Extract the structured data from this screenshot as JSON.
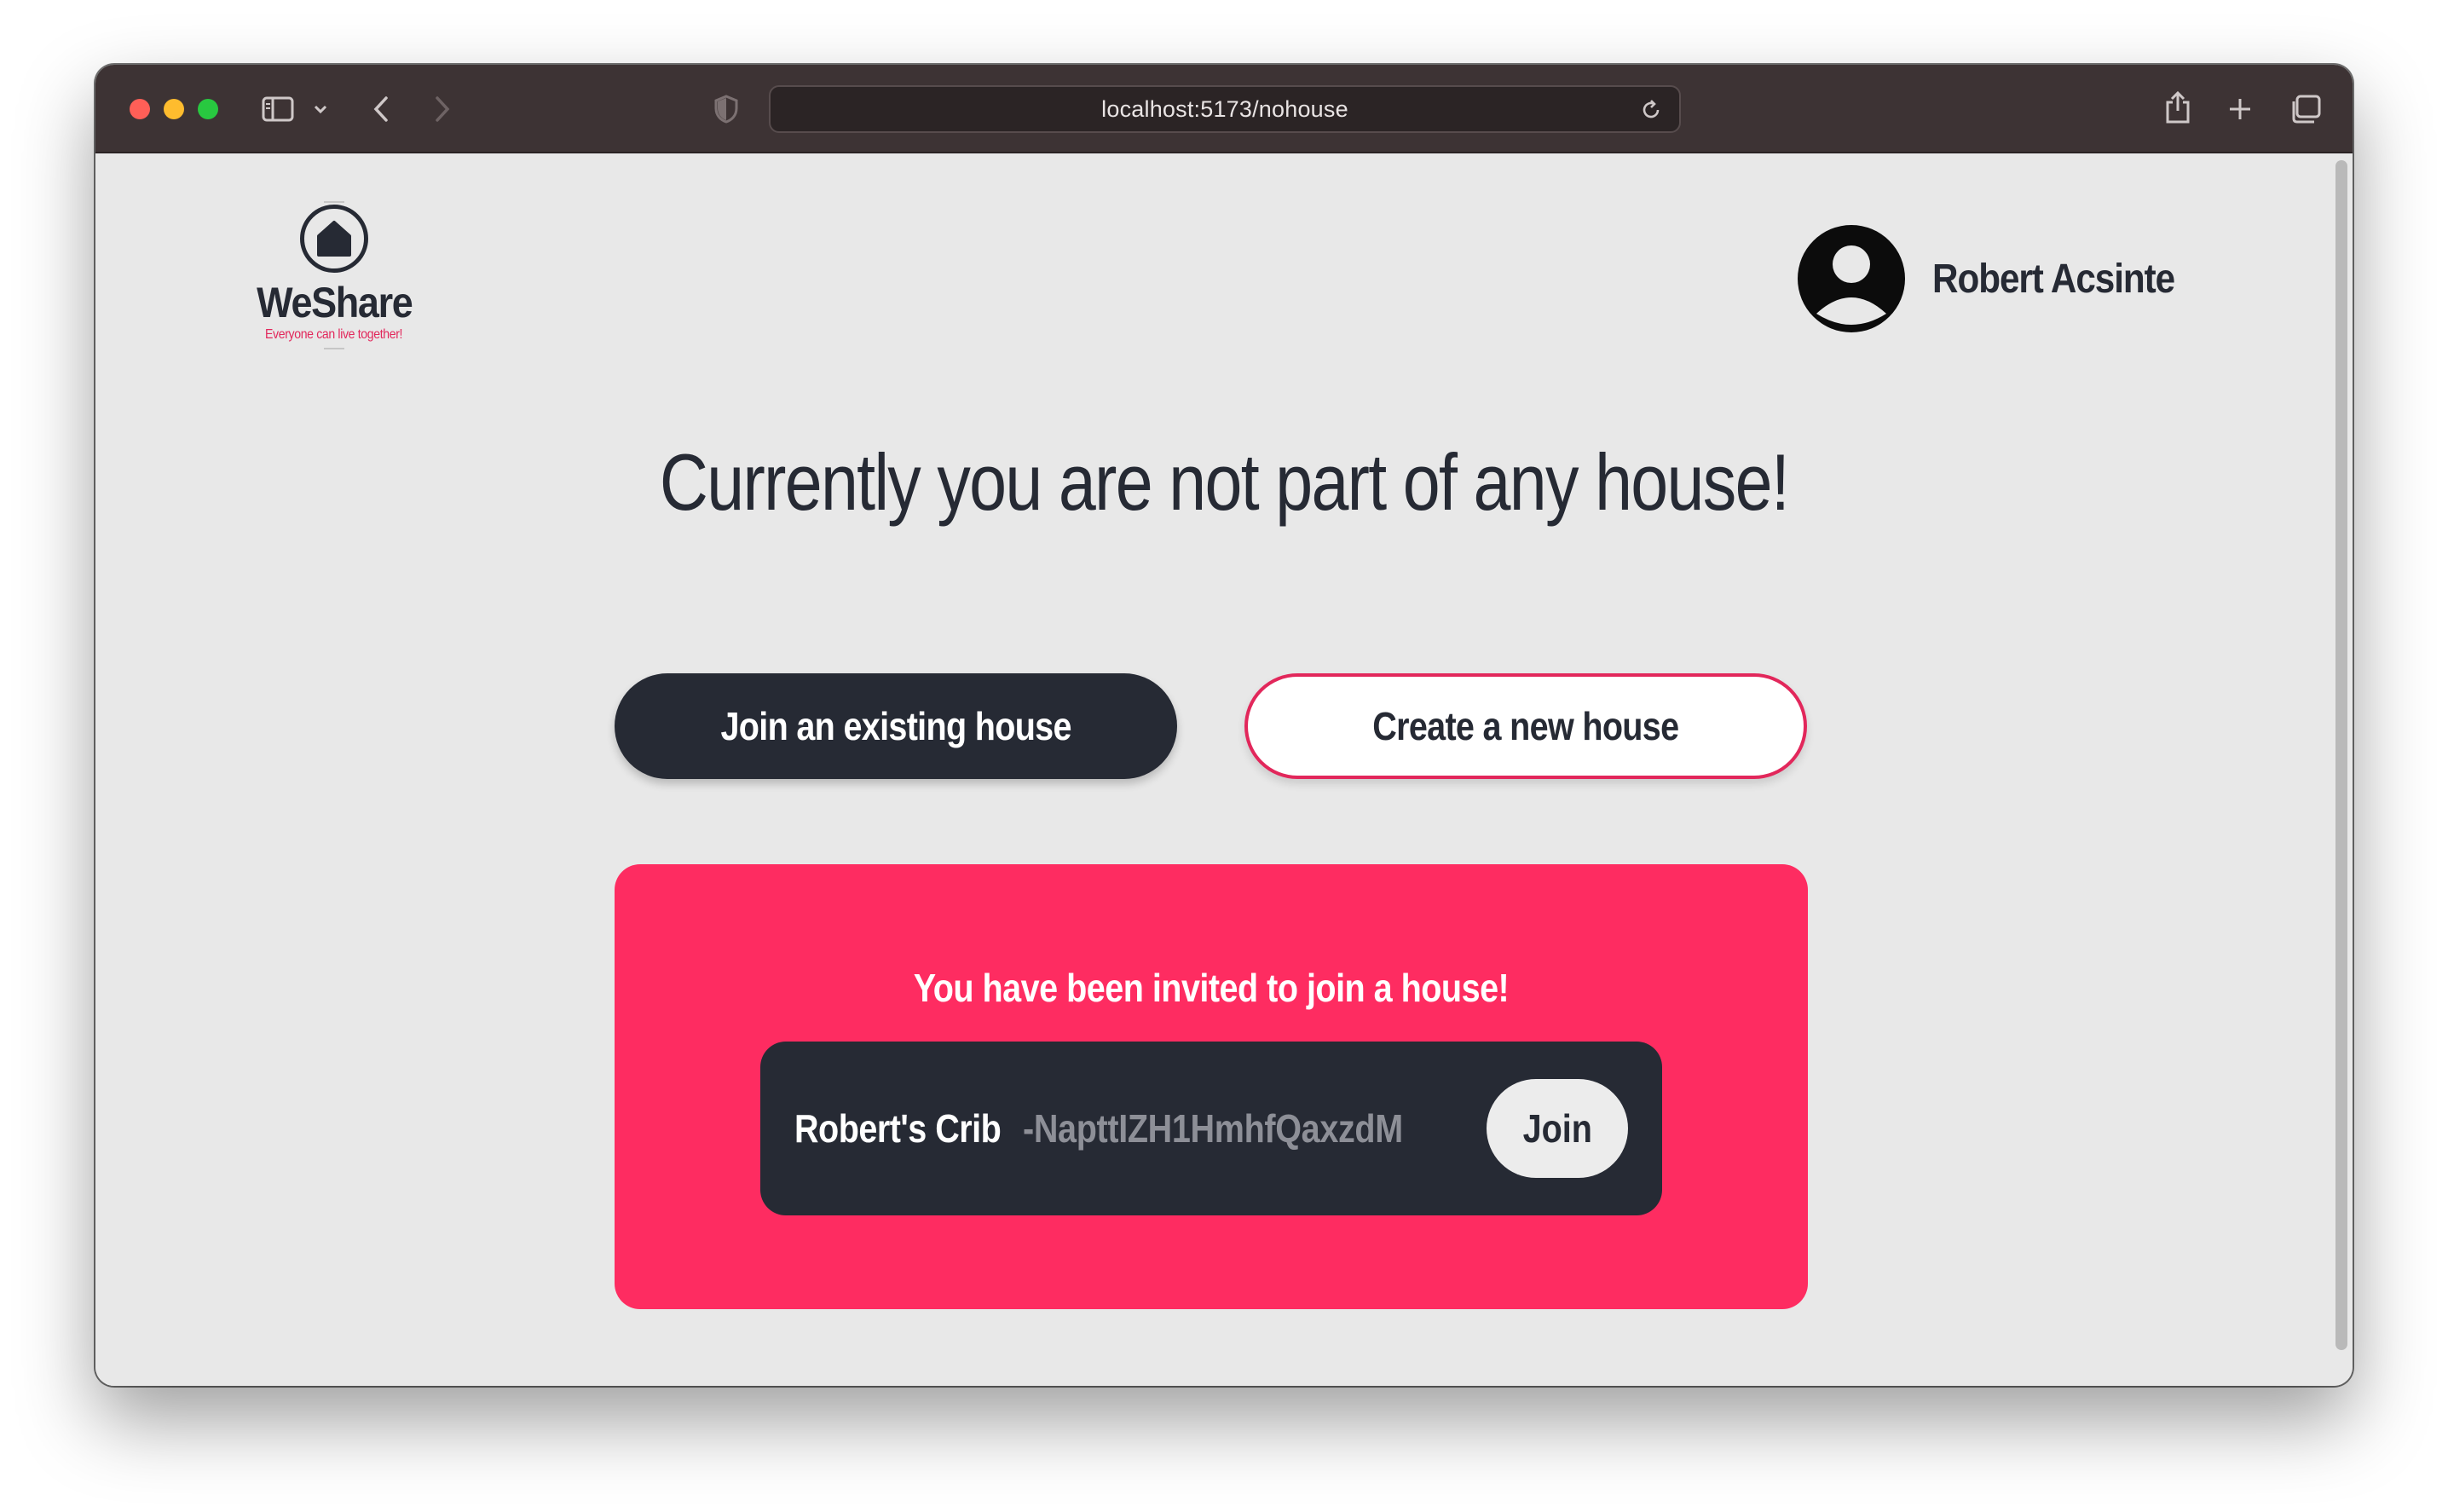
{
  "browser": {
    "url": "localhost:5173/nohouse",
    "icons": [
      "sidebar-icon",
      "chevron-down-icon",
      "back-icon",
      "forward-icon",
      "shield-icon",
      "reload-icon",
      "share-icon",
      "new-tab-icon",
      "tabs-overview-icon"
    ]
  },
  "brand": {
    "name": "WeShare",
    "tagline": "Everyone can live together!",
    "icon": "home-icon",
    "colors": {
      "dark": "#262a34",
      "accent": "#fe2c61",
      "background": "#e8e8e8"
    }
  },
  "user": {
    "name": "Robert Acsinte",
    "avatar_icon": "user-avatar-icon"
  },
  "main": {
    "headline": "Currently you are not part of any house!",
    "join_button": "Join an existing house",
    "create_button": "Create a new house"
  },
  "invitation": {
    "title": "You have been invited to join a house!",
    "house_name": "Robert's Crib",
    "house_id": "-NapttIZH1HmhfQaxzdM",
    "join_label": "Join"
  }
}
